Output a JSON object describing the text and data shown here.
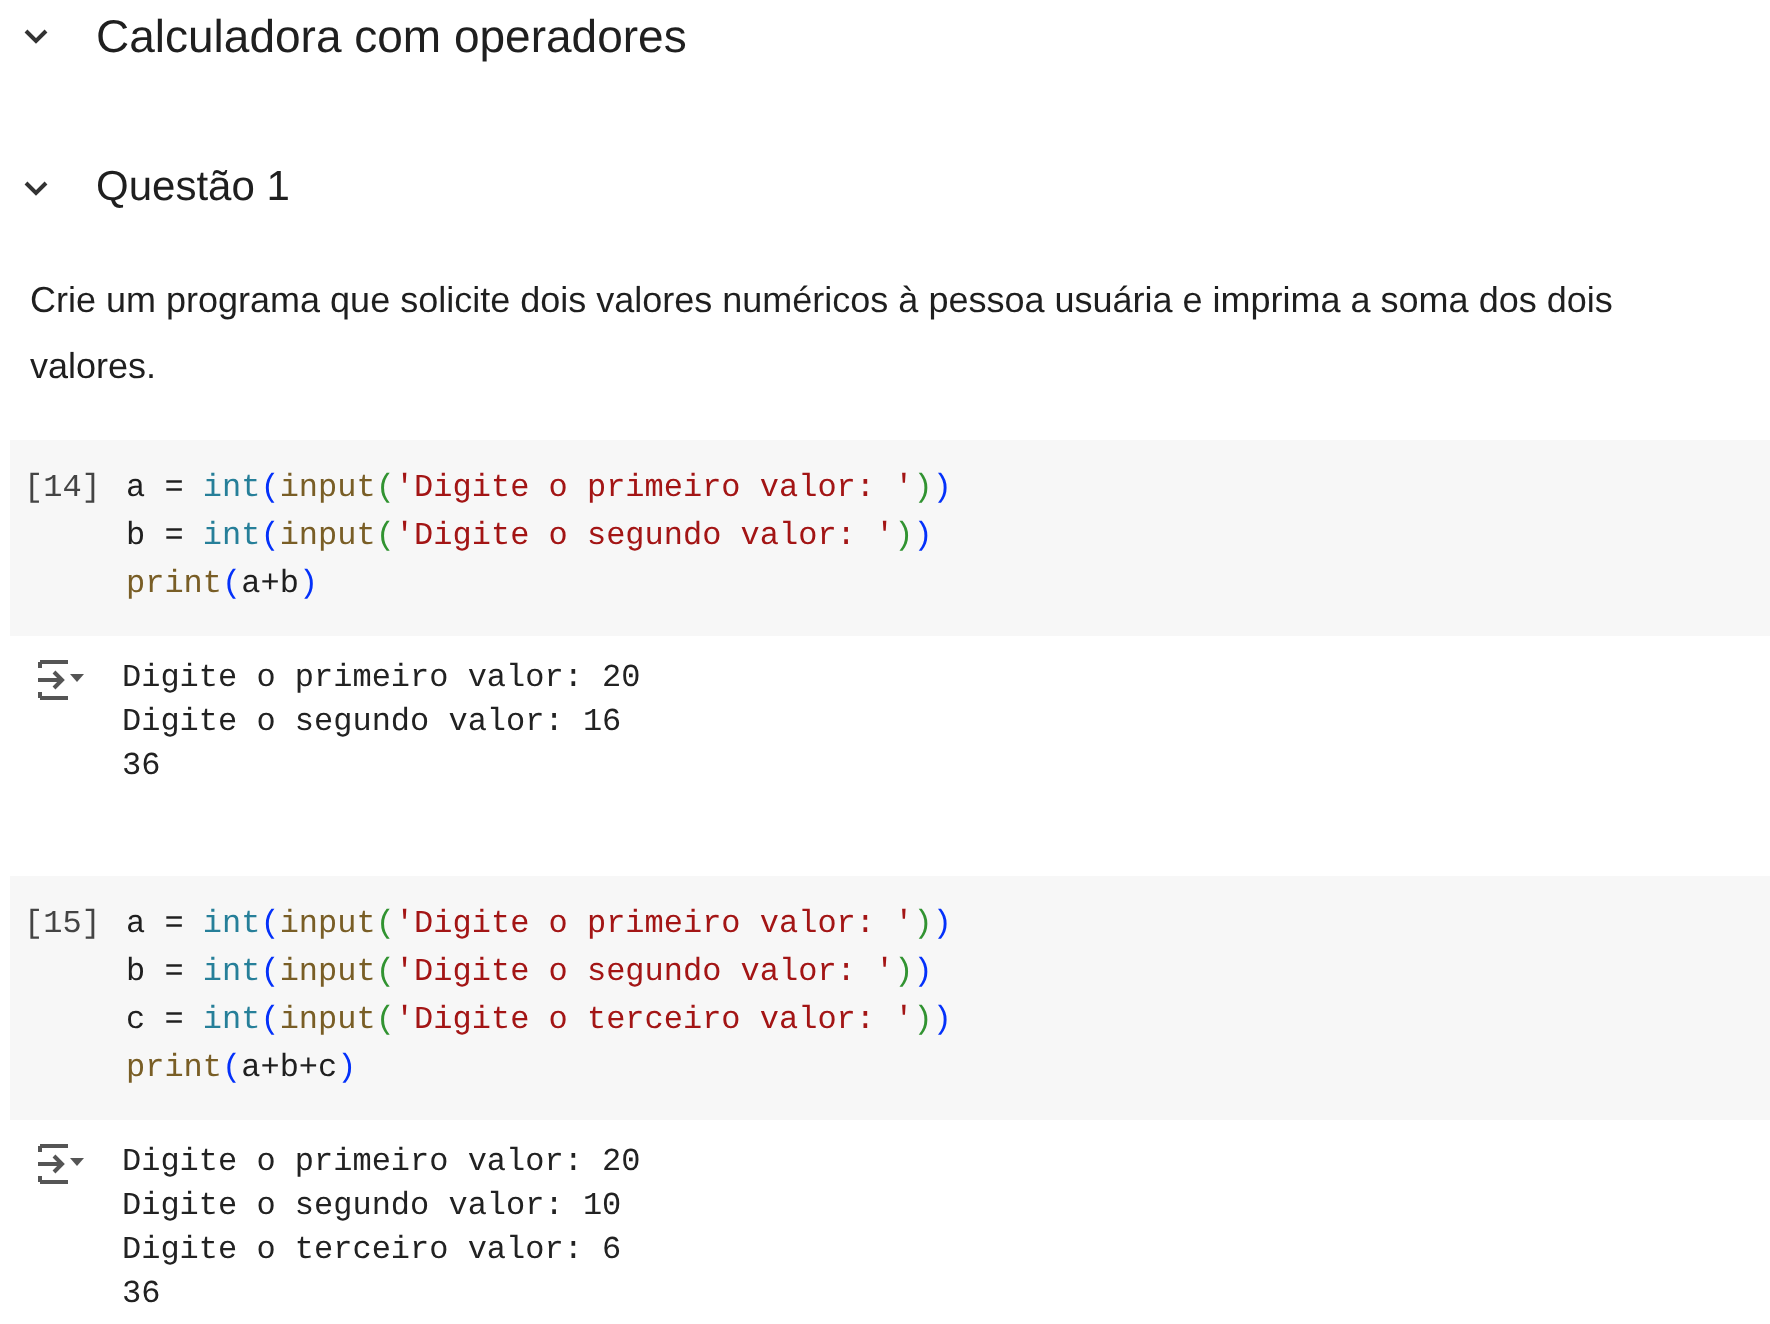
{
  "headings": [
    {
      "text": "Calculadora com operadores",
      "expanded": true,
      "kind": "title"
    },
    {
      "text": "Questão 1",
      "expanded": true,
      "kind": "section"
    }
  ],
  "paragraph": "Crie um programa que solicite dois valores numéricos à pessoa usuária e imprima a soma dos dois valores.",
  "cells": [
    {
      "execution_count": "[14]",
      "code": [
        [
          {
            "kind": "plain",
            "text": "a = "
          },
          {
            "kind": "builtin",
            "text": "int"
          },
          {
            "kind": "paren1",
            "text": "("
          },
          {
            "kind": "func",
            "text": "input"
          },
          {
            "kind": "paren2",
            "text": "("
          },
          {
            "kind": "string",
            "text": "'Digite o primeiro valor: '"
          },
          {
            "kind": "paren2",
            "text": ")"
          },
          {
            "kind": "paren1",
            "text": ")"
          }
        ],
        [
          {
            "kind": "plain",
            "text": "b = "
          },
          {
            "kind": "builtin",
            "text": "int"
          },
          {
            "kind": "paren1",
            "text": "("
          },
          {
            "kind": "func",
            "text": "input"
          },
          {
            "kind": "paren2",
            "text": "("
          },
          {
            "kind": "string",
            "text": "'Digite o segundo valor: '"
          },
          {
            "kind": "paren2",
            "text": ")"
          },
          {
            "kind": "paren1",
            "text": ")"
          }
        ],
        [
          {
            "kind": "func",
            "text": "print"
          },
          {
            "kind": "paren1",
            "text": "("
          },
          {
            "kind": "plain",
            "text": "a+b"
          },
          {
            "kind": "paren1",
            "text": ")"
          }
        ]
      ],
      "output": [
        "Digite o primeiro valor: 20",
        "Digite o segundo valor: 16",
        "36"
      ]
    },
    {
      "execution_count": "[15]",
      "code": [
        [
          {
            "kind": "plain",
            "text": "a = "
          },
          {
            "kind": "builtin",
            "text": "int"
          },
          {
            "kind": "paren1",
            "text": "("
          },
          {
            "kind": "func",
            "text": "input"
          },
          {
            "kind": "paren2",
            "text": "("
          },
          {
            "kind": "string",
            "text": "'Digite o primeiro valor: '"
          },
          {
            "kind": "paren2",
            "text": ")"
          },
          {
            "kind": "paren1",
            "text": ")"
          }
        ],
        [
          {
            "kind": "plain",
            "text": "b = "
          },
          {
            "kind": "builtin",
            "text": "int"
          },
          {
            "kind": "paren1",
            "text": "("
          },
          {
            "kind": "func",
            "text": "input"
          },
          {
            "kind": "paren2",
            "text": "("
          },
          {
            "kind": "string",
            "text": "'Digite o segundo valor: '"
          },
          {
            "kind": "paren2",
            "text": ")"
          },
          {
            "kind": "paren1",
            "text": ")"
          }
        ],
        [
          {
            "kind": "plain",
            "text": "c = "
          },
          {
            "kind": "builtin",
            "text": "int"
          },
          {
            "kind": "paren1",
            "text": "("
          },
          {
            "kind": "func",
            "text": "input"
          },
          {
            "kind": "paren2",
            "text": "("
          },
          {
            "kind": "string",
            "text": "'Digite o terceiro valor: '"
          },
          {
            "kind": "paren2",
            "text": ")"
          },
          {
            "kind": "paren1",
            "text": ")"
          }
        ],
        [
          {
            "kind": "func",
            "text": "print"
          },
          {
            "kind": "paren1",
            "text": "("
          },
          {
            "kind": "plain",
            "text": "a+b+c"
          },
          {
            "kind": "paren1",
            "text": ")"
          }
        ]
      ],
      "output": [
        "Digite o primeiro valor: 20",
        "Digite o segundo valor: 10",
        "Digite o terceiro valor: 6",
        "36"
      ]
    }
  ]
}
